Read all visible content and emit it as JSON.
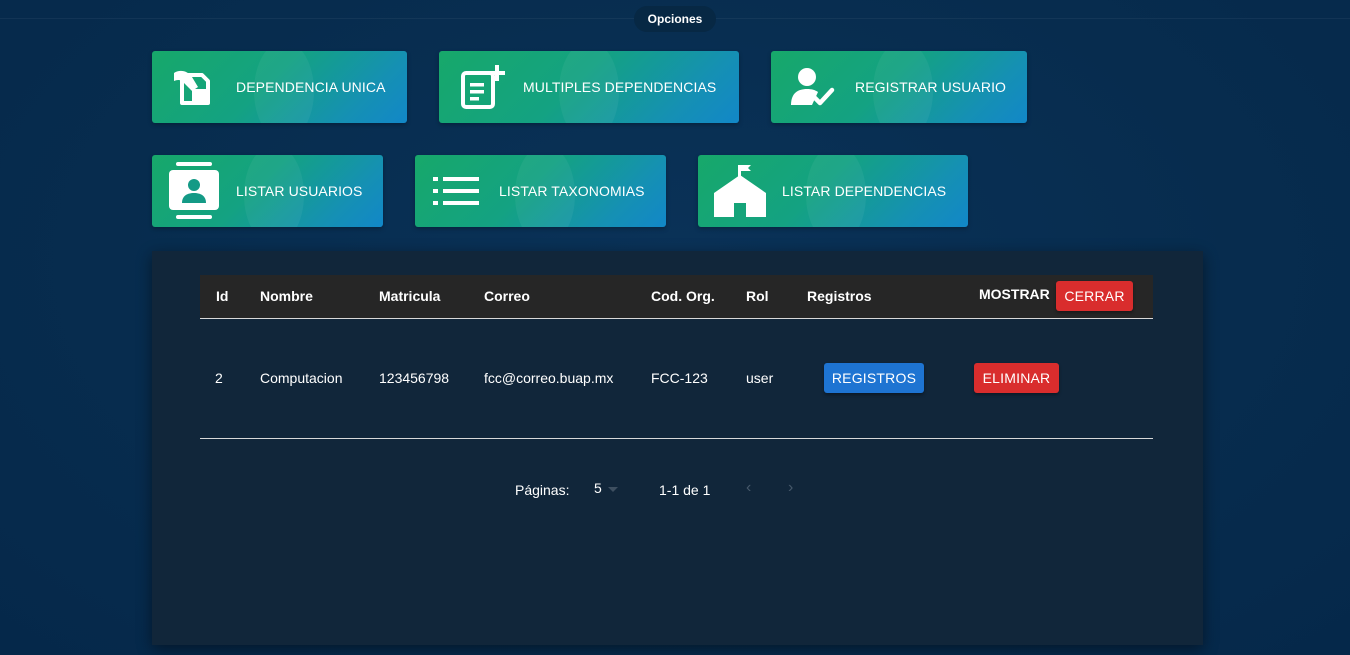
{
  "header": {
    "options_label": "Opciones"
  },
  "options": [
    {
      "label": "DEPENDENCIA UNICA",
      "icon": "single-dependency-icon"
    },
    {
      "label": "MULTIPLES DEPENDENCIAS",
      "icon": "add-document-icon"
    },
    {
      "label": "REGISTRAR USUARIO",
      "icon": "user-check-icon"
    },
    {
      "label": "LISTAR USUARIOS",
      "icon": "contact-card-icon"
    },
    {
      "label": "LISTAR TAXONOMIAS",
      "icon": "list-icon"
    },
    {
      "label": "LISTAR DEPENDENCIAS",
      "icon": "school-icon"
    }
  ],
  "table": {
    "headers": {
      "id": "Id",
      "nombre": "Nombre",
      "matricula": "Matricula",
      "correo": "Correo",
      "cod_org": "Cod. Org.",
      "rol": "Rol",
      "registros": "Registros",
      "mostrar": "MOSTRAR"
    },
    "close_label": "CERRAR",
    "rows": [
      {
        "id": "2",
        "nombre": "Computacion",
        "matricula": "123456798",
        "correo": "fcc@correo.buap.mx",
        "cod_org": "FCC-123",
        "rol": "user",
        "registros_label": "REGISTROS",
        "delete_label": "ELIMINAR"
      }
    ]
  },
  "pagination": {
    "rows_label": "Páginas:",
    "rows_per_page": "5",
    "range": "1-1 de 1"
  },
  "colors": {
    "background": "#062d4f",
    "panel": "#11263a",
    "accent_red": "#d92d2d",
    "accent_blue": "#1e74d2",
    "gradient_start": "#17a86a",
    "gradient_end": "#1287c8"
  }
}
